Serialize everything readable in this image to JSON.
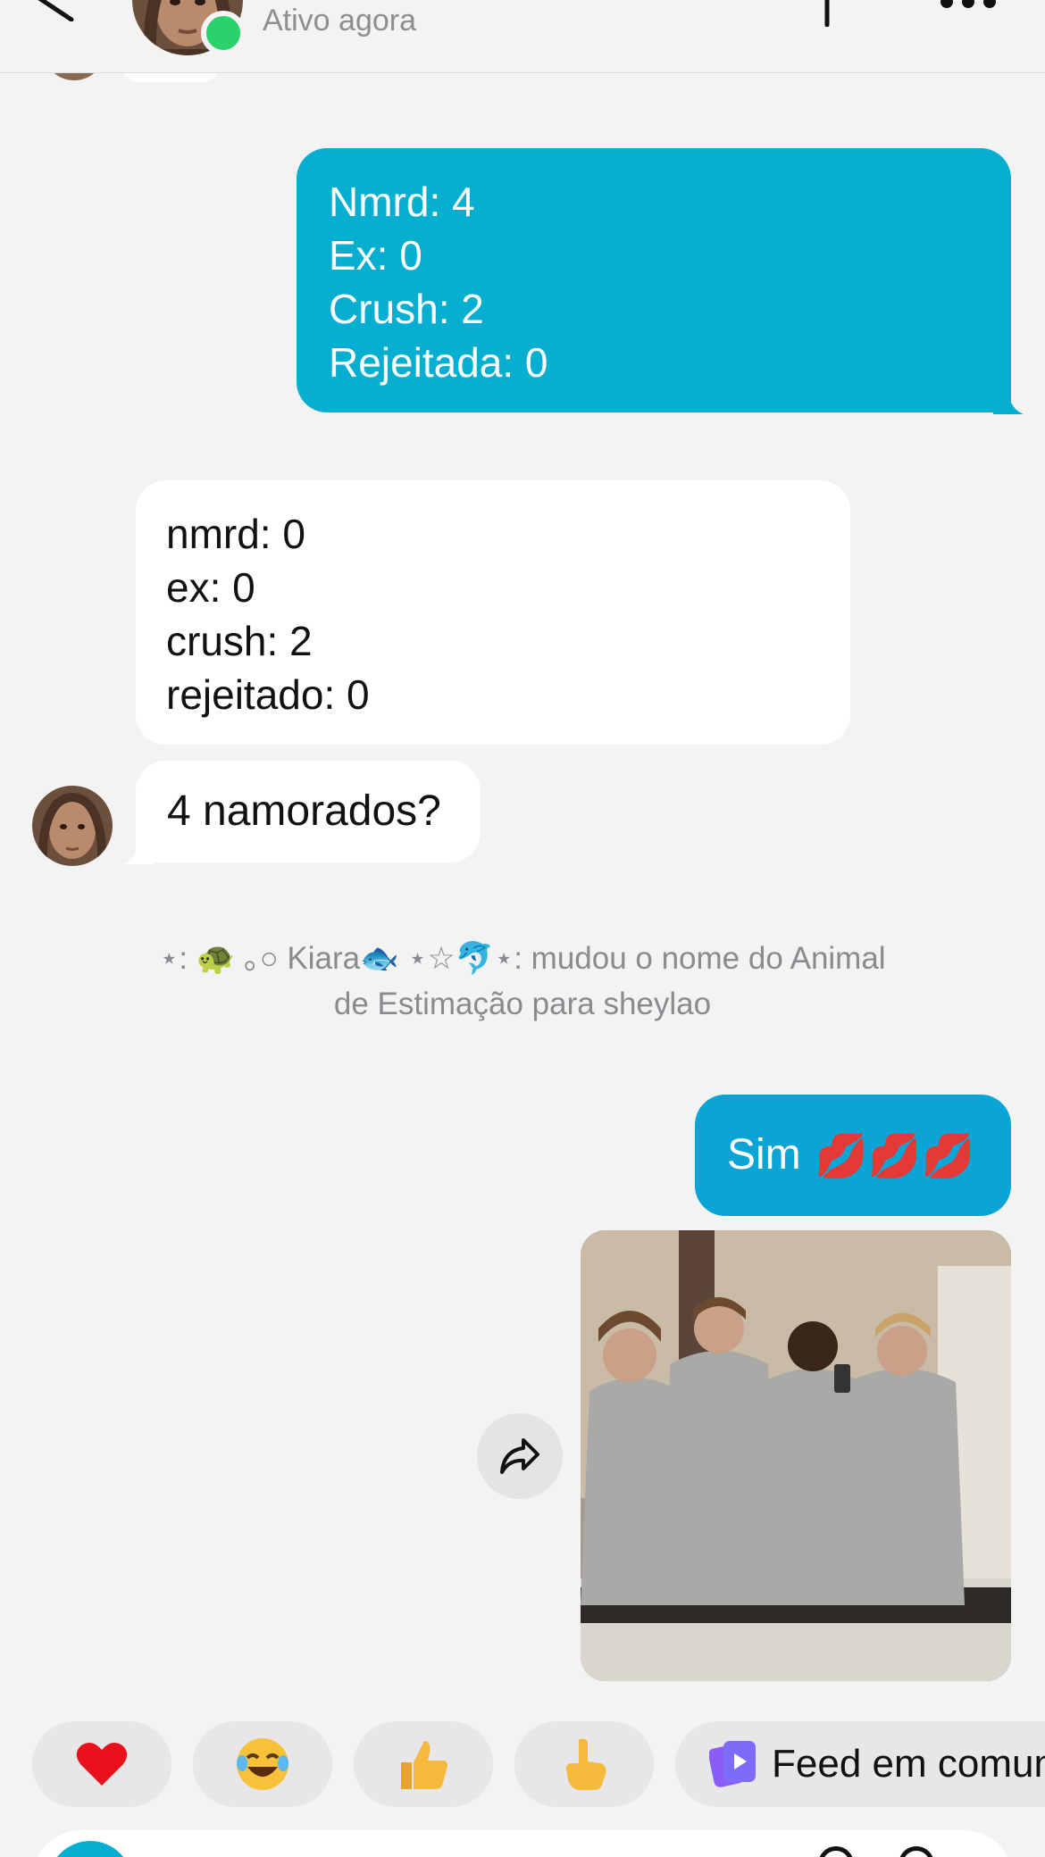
{
  "header": {
    "status": "Ativo agora",
    "online_color": "#2bd16b",
    "icons": [
      "back-icon",
      "avatar",
      "flag-icon",
      "more-icon"
    ]
  },
  "messages": {
    "outgoing_stats": [
      "Nmrd: 4",
      "Ex: 0",
      "Crush: 2",
      "Rejeitada: 0"
    ],
    "incoming_stats": [
      "nmrd: 0",
      "ex: 0",
      "crush: 2",
      "rejeitado: 0"
    ],
    "incoming_question": "4 namorados?",
    "system_note": {
      "line1": "⋆: 🐢 ｡○ Kiara🐟 ⋆☆🐬⋆: mudou o nome do Animal",
      "line2": "de Estimação para sheylao"
    },
    "outgoing_reply": "Sim",
    "outgoing_reply_emoji": "💋💋💋"
  },
  "colors": {
    "outgoing_bubble": "#06aed0",
    "incoming_bubble": "#ffffff",
    "background": "#f3f3f4"
  },
  "quick_reactions": {
    "emojis": [
      "❤️",
      "😂",
      "👍",
      "👆"
    ],
    "feed_label": "Feed em comum"
  }
}
